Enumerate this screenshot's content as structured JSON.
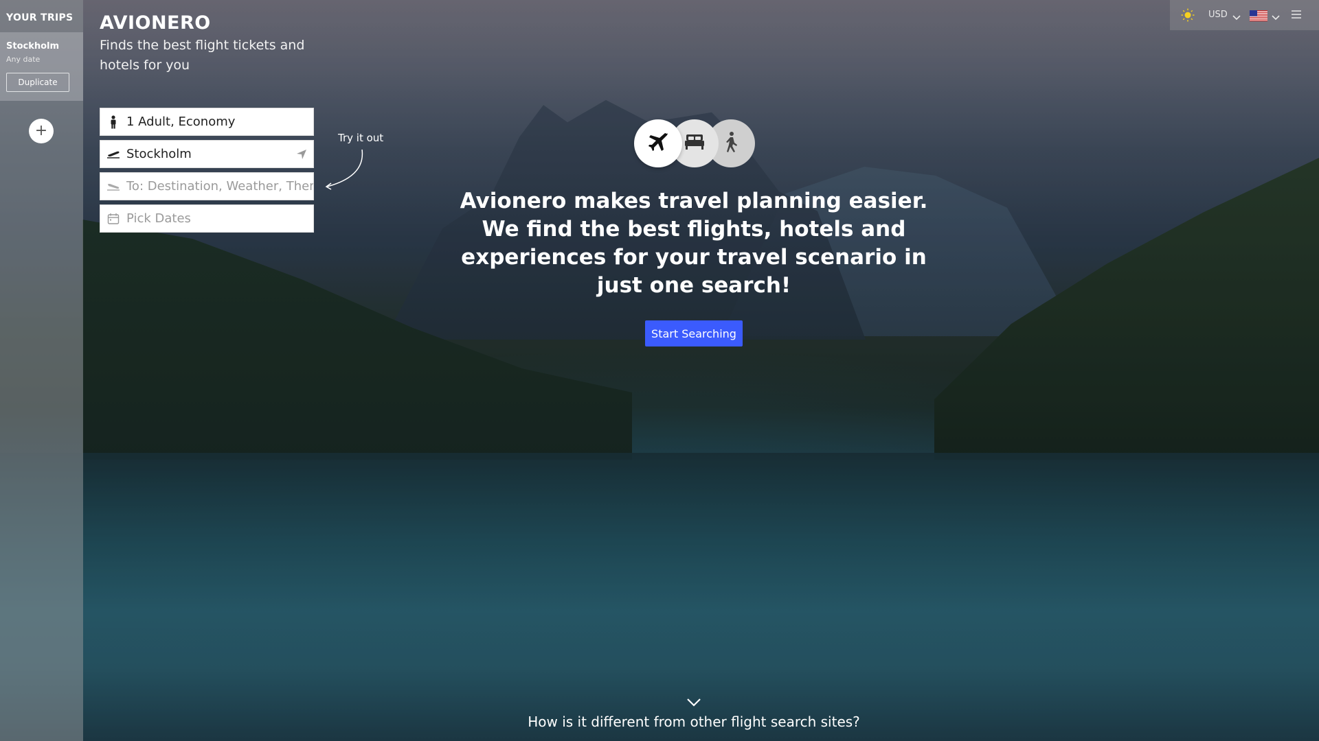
{
  "sidebar": {
    "title": "YOUR TRIPS",
    "trip": {
      "name": "Stockholm",
      "date": "Any date",
      "duplicate_label": "Duplicate"
    },
    "add_label": "+"
  },
  "brand": {
    "name": "AVIONERO",
    "tagline": "Finds the best flight tickets and hotels for you"
  },
  "search": {
    "passengers": "1 Adult, Economy",
    "origin": "Stockholm",
    "destination_placeholder": "To: Destination, Weather, Them",
    "dates_placeholder": "Pick Dates"
  },
  "hint": {
    "try_it_out": "Try it out"
  },
  "modes": [
    "plane-icon",
    "bed-icon",
    "walking-icon"
  ],
  "hero": {
    "headline": "Avionero makes travel planning easier. We find the best flights, hotels and experiences for your travel scenario in just one search!",
    "cta": "Start Searching"
  },
  "topbar": {
    "currency": "USD",
    "flag": "us-flag-icon"
  },
  "bottom": {
    "question": "How is it different from other flight search sites?"
  },
  "colors": {
    "accent": "#3b5bfd"
  }
}
